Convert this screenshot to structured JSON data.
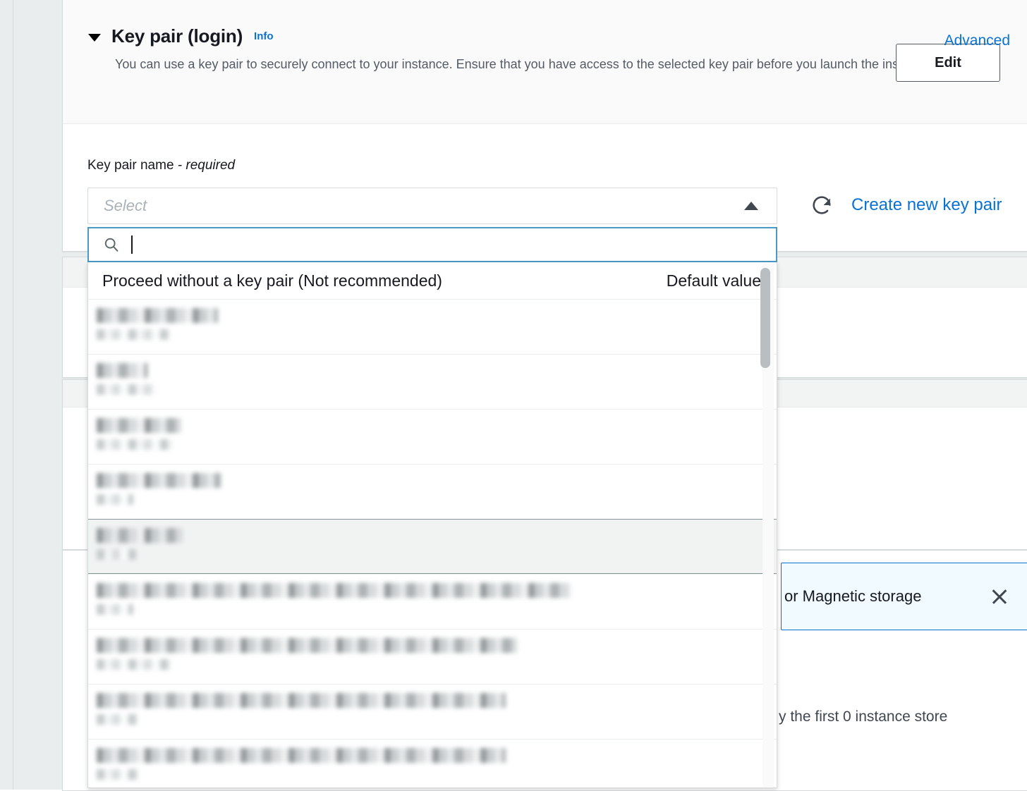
{
  "section": {
    "title": "Key pair (login)",
    "info_label": "Info",
    "description": "You can use a key pair to securely connect to your instance. Ensure that you have access to the selected key pair before you launch the instance.",
    "caret_icon": "caret-down-icon"
  },
  "field": {
    "label": "Key pair name",
    "required_suffix": "- required"
  },
  "select": {
    "placeholder": "Select",
    "caret_icon": "caret-up-icon",
    "expanded": true
  },
  "actions": {
    "refresh_icon": "refresh-icon",
    "create_link": "Create new key pair"
  },
  "search": {
    "icon": "search-icon",
    "value": "",
    "placeholder": ""
  },
  "dropdown": {
    "header_option": "Proceed without a key pair (Not recommended)",
    "header_badge": "Default value",
    "options": [
      {
        "redacted": true,
        "hovered": false,
        "line1_width": 172,
        "line2_width": 104
      },
      {
        "redacted": true,
        "hovered": false,
        "line1_width": 72,
        "line2_width": 86
      },
      {
        "redacted": true,
        "hovered": false,
        "line1_width": 120,
        "line2_width": 108
      },
      {
        "redacted": true,
        "hovered": false,
        "line1_width": 176,
        "line2_width": 52
      },
      {
        "redacted": true,
        "hovered": true,
        "line1_width": 122,
        "line2_width": 56
      },
      {
        "redacted": true,
        "hovered": false,
        "line1_width": 672,
        "line2_width": 52
      },
      {
        "redacted": true,
        "hovered": false,
        "line1_width": 596,
        "line2_width": 106
      },
      {
        "redacted": true,
        "hovered": false,
        "line1_width": 580,
        "line2_width": 58
      },
      {
        "redacted": true,
        "hovered": false,
        "line1_width": 580,
        "line2_width": 60
      }
    ],
    "scroll_position_pct": 6
  },
  "right_panel": {
    "edit_button": "Edit",
    "advanced_link": "Advanced",
    "alert_text": "or Magnetic storage",
    "alert_close_icon": "close-icon",
    "storage_note": "y the first 0 instance store"
  },
  "colors": {
    "accent_blue": "#0972d3",
    "focus_border": "#4a9ac4",
    "page_bg": "#eaeded",
    "card_header_bg": "#fafafa",
    "alert_bg": "#f1faff",
    "hover_bg": "#f1f3f3"
  }
}
